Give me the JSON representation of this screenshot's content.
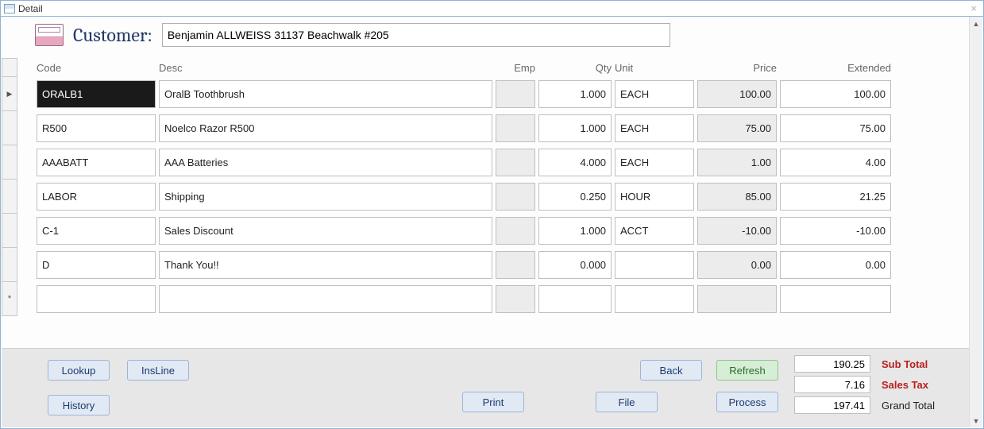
{
  "window": {
    "title": "Detail"
  },
  "header": {
    "label": "Customer:",
    "customer": "Benjamin ALLWEISS 31137 Beachwalk #205"
  },
  "columns": {
    "code": "Code",
    "desc": "Desc",
    "emp": "Emp",
    "qty": "Qty",
    "unit": "Unit",
    "price": "Price",
    "extended": "Extended"
  },
  "lines": [
    {
      "code": "ORALB1",
      "desc": "OralB Toothbrush",
      "emp": "",
      "qty": "1.000",
      "unit": "EACH",
      "price": "100.00",
      "ext": "100.00",
      "selected": true
    },
    {
      "code": "R500",
      "desc": "Noelco Razor R500",
      "emp": "",
      "qty": "1.000",
      "unit": "EACH",
      "price": "75.00",
      "ext": "75.00"
    },
    {
      "code": "AAABATT",
      "desc": "AAA Batteries",
      "emp": "",
      "qty": "4.000",
      "unit": "EACH",
      "price": "1.00",
      "ext": "4.00"
    },
    {
      "code": "LABOR",
      "desc": "Shipping",
      "emp": "",
      "qty": "0.250",
      "unit": "HOUR",
      "price": "85.00",
      "ext": "21.25"
    },
    {
      "code": "C-1",
      "desc": "Sales Discount",
      "emp": "",
      "qty": "1.000",
      "unit": "ACCT",
      "price": "-10.00",
      "ext": "-10.00"
    },
    {
      "code": "D",
      "desc": "Thank You!!",
      "emp": "",
      "qty": "0.000",
      "unit": "",
      "price": "0.00",
      "ext": "0.00"
    },
    {
      "code": "",
      "desc": "",
      "emp": "",
      "qty": "",
      "unit": "",
      "price": "",
      "ext": "",
      "new": true
    }
  ],
  "buttons": {
    "lookup": "Lookup",
    "insline": "InsLine",
    "history": "History",
    "back": "Back",
    "refresh": "Refresh",
    "print": "Print",
    "file": "File",
    "process": "Process"
  },
  "totals": {
    "subtotal_label": "Sub Total",
    "subtotal": "190.25",
    "salestax_label": "Sales Tax",
    "salestax": "7.16",
    "grandtotal_label": "Grand Total",
    "grandtotal": "197.41"
  }
}
